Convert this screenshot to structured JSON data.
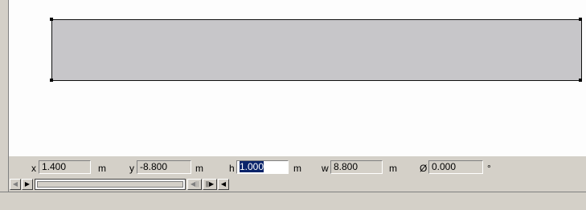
{
  "properties": {
    "x": {
      "label": "x",
      "value": "1.400",
      "unit": "m"
    },
    "y": {
      "label": "y",
      "value": "-8.800",
      "unit": "m"
    },
    "h": {
      "label": "h",
      "value": "1.000",
      "unit": "m"
    },
    "w": {
      "label": "w",
      "value": "8.800",
      "unit": "m"
    },
    "angle": {
      "label": "Ø",
      "value": "0.000",
      "unit": "°"
    }
  },
  "colors": {
    "shape_fill": "#c7c6c9",
    "chrome": "#d4d0c8",
    "selection": "#0a246a"
  },
  "icons": {
    "scroll_left": "◀",
    "scroll_right": "▶",
    "page_prev": "◀||",
    "page_next": "||▶",
    "page_back": "◀"
  }
}
